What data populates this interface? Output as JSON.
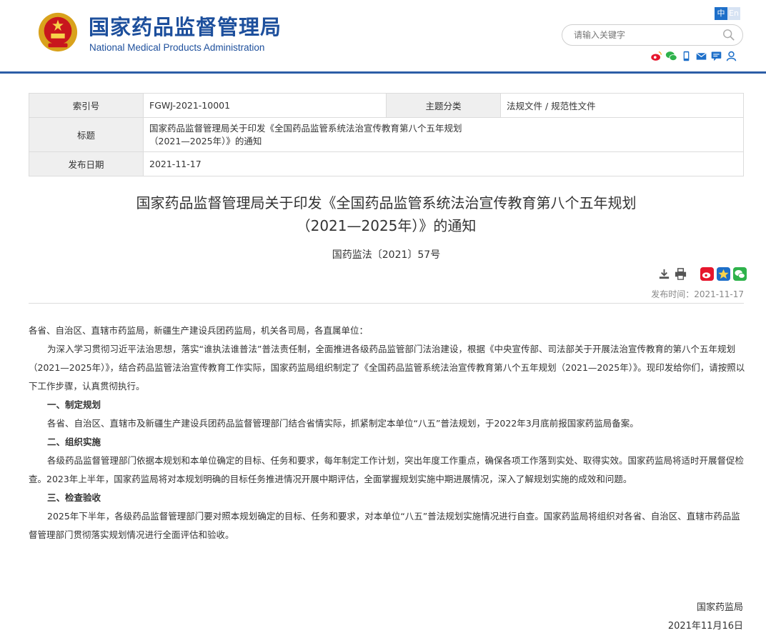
{
  "header": {
    "title_cn": "国家药品监督管理局",
    "title_en": "National Medical Products Administration",
    "lang_zh": "中",
    "lang_en": "En",
    "search_placeholder": "请输入关键字",
    "share_icons": [
      "weibo-icon",
      "wechat-icon",
      "mobile-icon",
      "mail-icon",
      "message-icon",
      "user-icon"
    ]
  },
  "meta": {
    "index_label": "索引号",
    "index_value": "FGWJ-2021-10001",
    "category_label": "主题分类",
    "category_value": "法规文件 / 规范性文件",
    "title_label": "标题",
    "title_value_line1": "国家药品监督管理局关于印发《全国药品监管系统法治宣传教育第八个五年规划",
    "title_value_line2": "（2021—2025年）》的通知",
    "date_label": "发布日期",
    "date_value": "2021-11-17"
  },
  "article": {
    "title_line1": "国家药品监督管理局关于印发《全国药品监管系统法治宣传教育第八个五年规划",
    "title_line2": "（2021—2025年）》的通知",
    "doc_number": "国药监法〔2021〕57号",
    "publish_time": "发布时间：2021-11-17",
    "salutation": "各省、自治区、直辖市药监局，新疆生产建设兵团药监局，机关各司局，各直属单位：",
    "intro": "为深入学习贯彻习近平法治思想，落实“谁执法谁普法”普法责任制，全面推进各级药品监管部门法治建设，根据《中央宣传部、司法部关于开展法治宣传教育的第八个五年规划（2021—2025年）》，结合药品监管法治宣传教育工作实际，国家药监局组织制定了《全国药品监管系统法治宣传教育第八个五年规划（2021—2025年）》。现印发给你们，请按照以下工作步骤，认真贯彻执行。",
    "s1_title": "一、制定规划",
    "s1_body": "各省、自治区、直辖市及新疆生产建设兵团药品监督管理部门结合省情实际，抓紧制定本单位“八五”普法规划，于2022年3月底前报国家药监局备案。",
    "s2_title": "二、组织实施",
    "s2_body": "各级药品监督管理部门依据本规划和本单位确定的目标、任务和要求，每年制定工作计划，突出年度工作重点，确保各项工作落到实处、取得实效。国家药监局将适时开展督促检查。2023年上半年，国家药监局将对本规划明确的目标任务推进情况开展中期评估，全面掌握规划实施中期进展情况，深入了解规划实施的成效和问题。",
    "s3_title": "三、检查验收",
    "s3_body": "2025年下半年，各级药品监督管理部门要对照本规划确定的目标、任务和要求，对本单位“八五”普法规划实施情况进行自查。国家药监局将组织对各省、自治区、直辖市药品监督管理部门贯彻落实规划情况进行全面评估和验收。",
    "signature": "国家药监局",
    "sign_date": "2021年11月16日"
  },
  "colors": {
    "brand_blue": "#1d4f9c",
    "header_line": "#2d5ea7"
  }
}
